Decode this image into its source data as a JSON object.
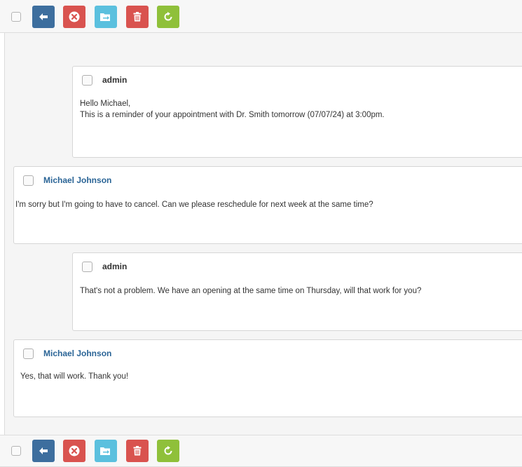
{
  "toolbar": {
    "buttons": [
      {
        "name": "back",
        "icon": "arrow-left-icon",
        "color": "#3d6e9e"
      },
      {
        "name": "delete",
        "icon": "close-circle-icon",
        "color": "#d9534f"
      },
      {
        "name": "move",
        "icon": "move-to-folder-icon",
        "color": "#5bc0de"
      },
      {
        "name": "trash",
        "icon": "trash-icon",
        "color": "#d9534f"
      },
      {
        "name": "refresh",
        "icon": "refresh-icon",
        "color": "#8fc03a"
      }
    ]
  },
  "messages": [
    {
      "author": "admin",
      "role": "staff",
      "lines": [
        "Hello Michael,",
        "This is a reminder of your appointment with Dr. Smith tomorrow (07/07/24) at 3:00pm."
      ]
    },
    {
      "author": "Michael Johnson",
      "role": "user",
      "lines": [
        "I'm sorry but I'm going to have to cancel. Can we please reschedule for next week at the same time?"
      ]
    },
    {
      "author": "admin",
      "role": "staff",
      "lines": [
        "That's not a problem. We have an opening at the same time on Thursday, will that work for you?"
      ]
    },
    {
      "author": "Michael Johnson",
      "role": "user",
      "lines": [
        "Yes, that will work. Thank you!"
      ]
    }
  ],
  "colors": {
    "user_name": "#2a6496",
    "admin_name": "#333333"
  }
}
